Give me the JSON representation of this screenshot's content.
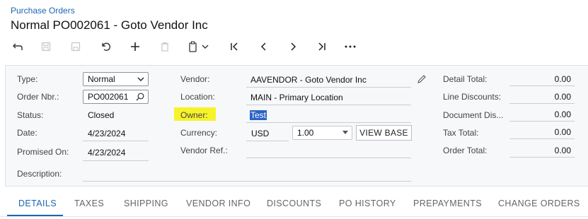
{
  "breadcrumb": "Purchase Orders",
  "title": "Normal PO002061 - Goto Vendor Inc",
  "toolbar": {
    "icons": [
      "back-icon",
      "save-close-icon",
      "save-icon",
      "undo-icon",
      "add-icon",
      "delete-icon",
      "copy-paste-icon",
      "chevron-down-icon",
      "first-record-icon",
      "previous-record-icon",
      "next-record-icon",
      "last-record-icon",
      "more-icon"
    ]
  },
  "summary": {
    "type_label": "Type:",
    "type_value": "Normal",
    "order_nbr_label": "Order Nbr.:",
    "order_nbr_value": "PO002061",
    "status_label": "Status:",
    "status_value": "Closed",
    "date_label": "Date:",
    "date_value": "4/23/2024",
    "promised_on_label": "Promised On:",
    "promised_on_value": "4/23/2024",
    "description_label": "Description:",
    "description_value": "",
    "vendor_label": "Vendor:",
    "vendor_value": "AAVENDOR - Goto Vendor Inc",
    "location_label": "Location:",
    "location_value": "MAIN - Primary Location",
    "owner_label": "Owner:",
    "owner_value": "Test",
    "currency_label": "Currency:",
    "currency_value": "USD",
    "rate_value": "1.00",
    "view_base_label": "VIEW BASE",
    "vendor_ref_label": "Vendor Ref.:",
    "vendor_ref_value": ""
  },
  "totals": [
    {
      "label": "Detail Total:",
      "value": "0.00"
    },
    {
      "label": "Line Discounts:",
      "value": "0.00"
    },
    {
      "label": "Document Dis...",
      "value": "0.00"
    },
    {
      "label": "Tax Total:",
      "value": "0.00"
    },
    {
      "label": "Order Total:",
      "value": "0.00"
    }
  ],
  "tabs": [
    "DETAILS",
    "TAXES",
    "SHIPPING",
    "VENDOR INFO",
    "DISCOUNTS",
    "PO HISTORY",
    "PREPAYMENTS",
    "CHANGE ORDERS"
  ],
  "colors": {
    "accent": "#1b66b1",
    "highlight": "#f7f32a",
    "selection": "#2a63c5"
  }
}
